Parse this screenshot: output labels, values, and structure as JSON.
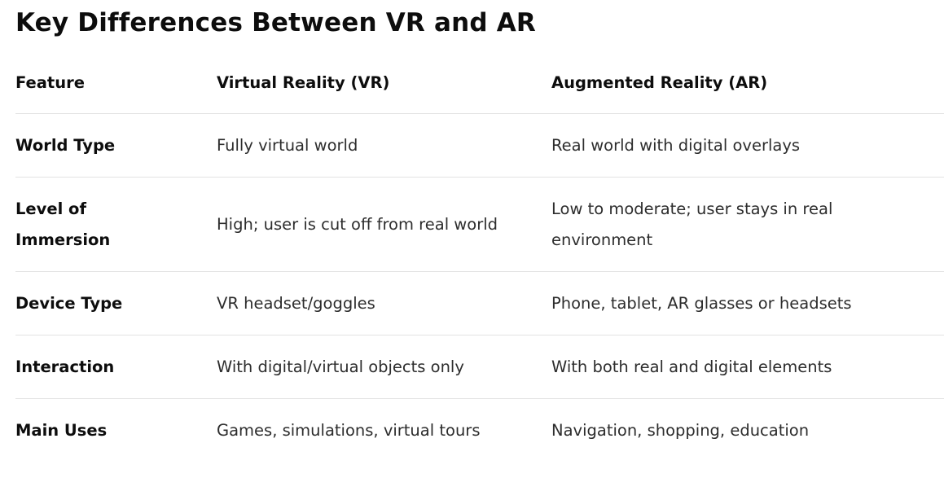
{
  "title": "Key Differences Between VR and AR",
  "table": {
    "headers": [
      "Feature",
      "Virtual Reality (VR)",
      "Augmented Reality (AR)"
    ],
    "rows": [
      {
        "feature": "World Type",
        "vr": "Fully virtual world",
        "ar": "Real world with digital overlays"
      },
      {
        "feature": "Level of Immersion",
        "vr": "High; user is cut off from real world",
        "ar": "Low to moderate; user stays in real environment"
      },
      {
        "feature": "Device Type",
        "vr": "VR headset/goggles",
        "ar": "Phone, tablet, AR glasses or headsets"
      },
      {
        "feature": "Interaction",
        "vr": "With digital/virtual objects only",
        "ar": "With both real and digital elements"
      },
      {
        "feature": "Main Uses",
        "vr": "Games, simulations, virtual tours",
        "ar": "Navigation, shopping, education"
      }
    ]
  }
}
